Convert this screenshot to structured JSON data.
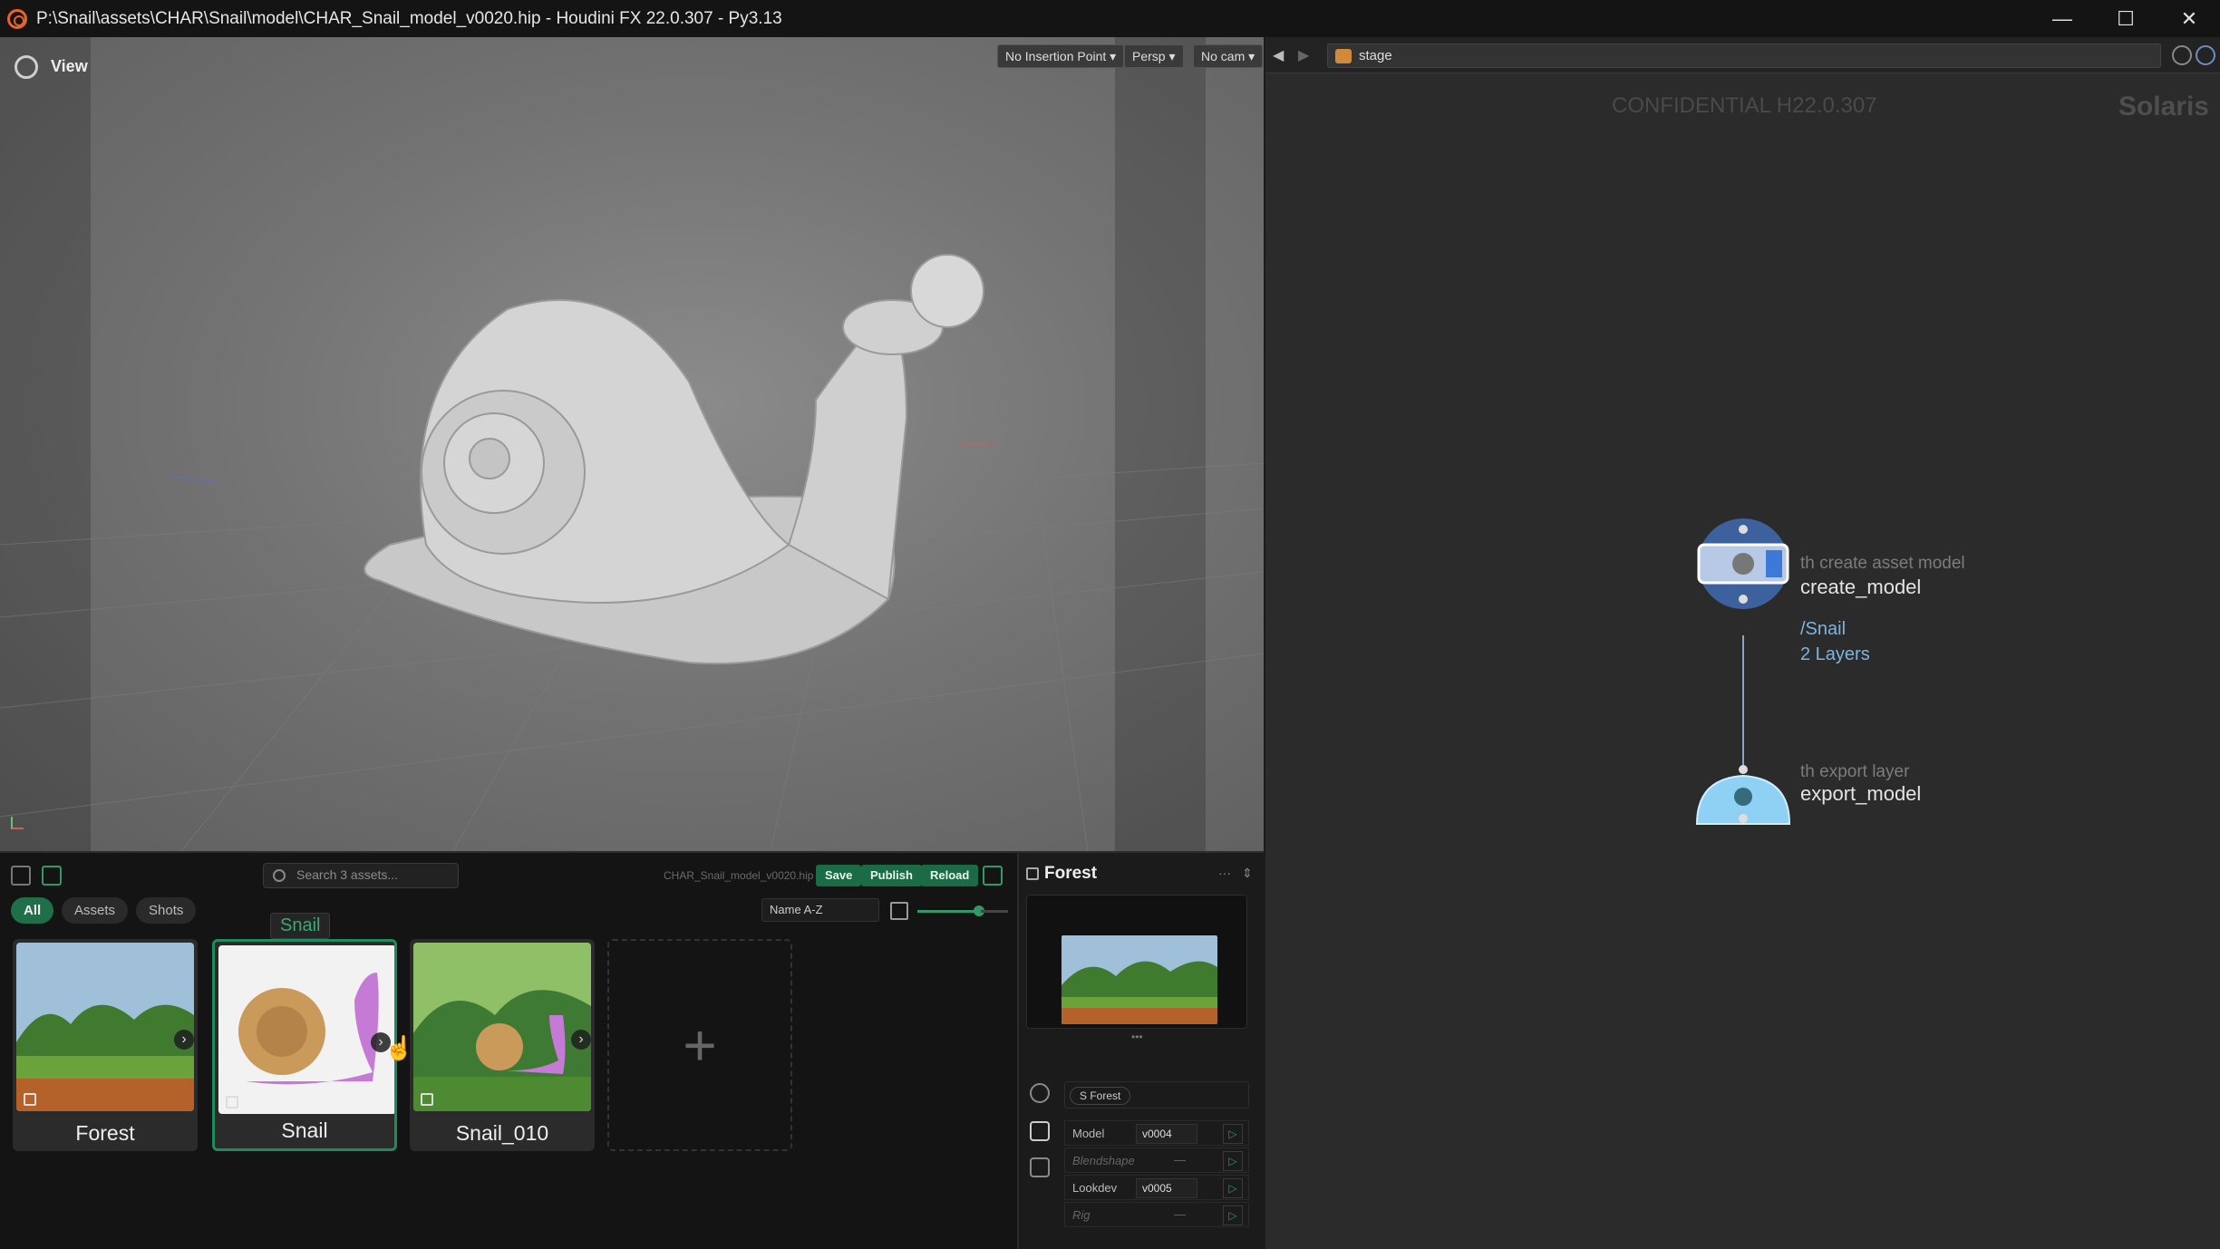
{
  "window": {
    "title": "P:\\Snail\\assets\\CHAR\\Snail\\model\\CHAR_Snail_model_v0020.hip - Houdini FX 22.0.307 - Py3.13",
    "minimize": "—",
    "maximize": "☐",
    "close": "✕"
  },
  "viewport": {
    "label": "View",
    "insertion_point": "No Insertion Point ▾",
    "camera_mode": "Persp ▾",
    "camera": "No cam ▾"
  },
  "network": {
    "path": "stage",
    "watermark": "CONFIDENTIAL H22.0.307",
    "context": "Solaris",
    "nodes": [
      {
        "subtitle": "th create asset model",
        "name": "create_model",
        "info": [
          "/Snail",
          "2 Layers"
        ]
      },
      {
        "subtitle": "th export layer",
        "name": "export_model"
      }
    ]
  },
  "browser": {
    "search_placeholder": "Search 3 assets...",
    "filename": "CHAR_Snail_model_v0020.hip",
    "buttons": {
      "save": "Save",
      "publish": "Publish",
      "reload": "Reload"
    },
    "filters": [
      "All",
      "Assets",
      "Shots"
    ],
    "active_filter": "All",
    "sort": "Name A-Z",
    "tooltip": "Snail",
    "cards": [
      {
        "label": "Forest",
        "kind": "asset"
      },
      {
        "label": "Snail",
        "kind": "asset",
        "selected": true
      },
      {
        "label": "Snail_010",
        "kind": "shot"
      }
    ],
    "add_label": "+"
  },
  "detail": {
    "title": "Forest",
    "menu": "···",
    "tag": "S Forest",
    "departments": [
      {
        "name": "Model",
        "version": "v0004",
        "active": true
      },
      {
        "name": "Blendshape",
        "version": "—",
        "active": false
      },
      {
        "name": "Lookdev",
        "version": "v0005",
        "active": true
      },
      {
        "name": "Rig",
        "version": "—",
        "active": false
      }
    ]
  },
  "colors": {
    "accent_green": "#1f6f4a",
    "node_blue": "#7fb3e0",
    "houdini_orange": "#e8632b"
  }
}
